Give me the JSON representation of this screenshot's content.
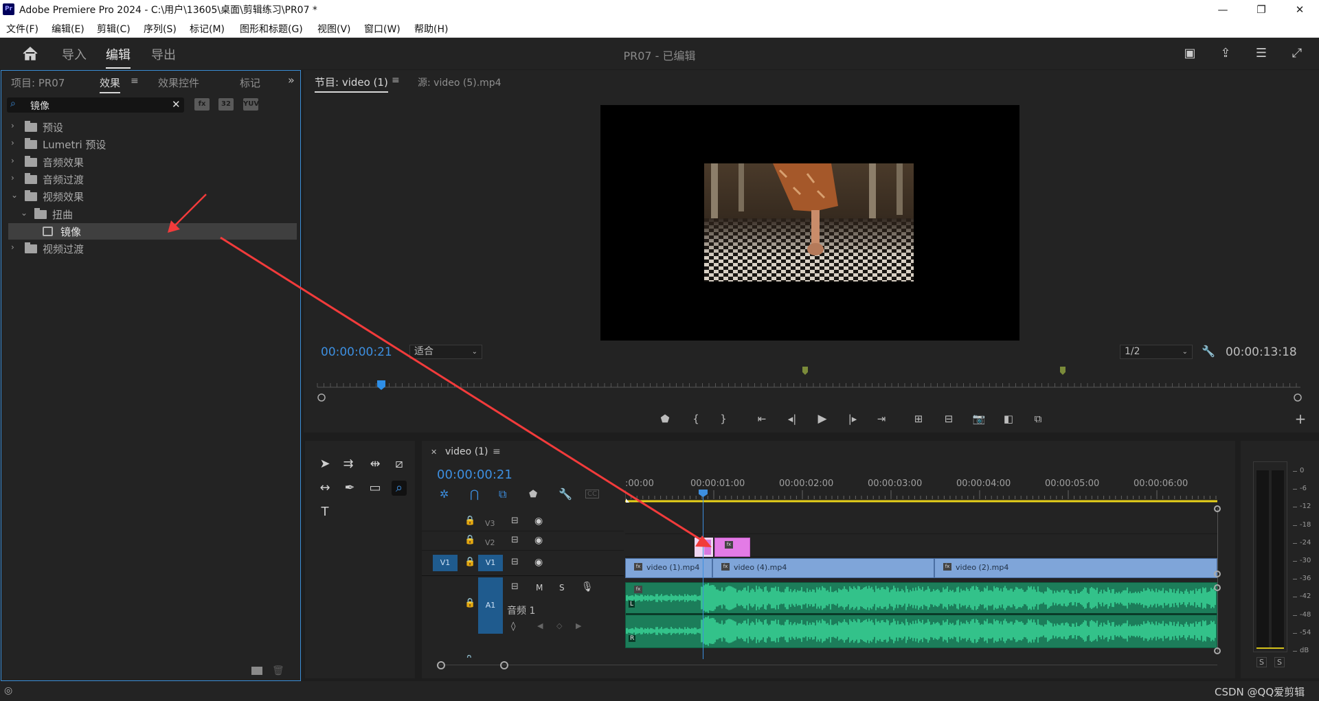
{
  "titlebar": {
    "app_title": "Adobe Premiere Pro 2024 - C:\\用户\\13605\\桌面\\剪辑练习\\PR07 *",
    "minimize": "—",
    "restore": "❐",
    "close": "✕"
  },
  "menu": [
    "文件(F)",
    "编辑(E)",
    "剪辑(C)",
    "序列(S)",
    "标记(M)",
    "图形和标题(G)",
    "视图(V)",
    "窗口(W)",
    "帮助(H)"
  ],
  "workspace": {
    "tabs": [
      "导入",
      "编辑",
      "导出"
    ],
    "active": "编辑",
    "doc_title": "PR07 - 已编辑"
  },
  "project_panel": {
    "tabs": [
      "项目: PR07",
      "效果",
      "效果控件",
      "标记"
    ],
    "active_tab": "效果",
    "search_value": "镜像",
    "filter_buttons": [
      "32",
      "YUV"
    ],
    "tree": [
      {
        "label": "预设",
        "level": 0,
        "expanded": false,
        "type": "preset-folder"
      },
      {
        "label": "Lumetri 预设",
        "level": 0,
        "expanded": false,
        "type": "preset-folder"
      },
      {
        "label": "音频效果",
        "level": 0,
        "expanded": false,
        "type": "folder"
      },
      {
        "label": "音频过渡",
        "level": 0,
        "expanded": false,
        "type": "folder"
      },
      {
        "label": "视频效果",
        "level": 0,
        "expanded": true,
        "type": "folder"
      },
      {
        "label": "扭曲",
        "level": 1,
        "expanded": true,
        "type": "folder"
      },
      {
        "label": "镜像",
        "level": 2,
        "selected": true,
        "type": "effect"
      },
      {
        "label": "视频过渡",
        "level": 0,
        "expanded": false,
        "type": "folder"
      }
    ]
  },
  "program_monitor": {
    "tabs": [
      "节目: video (1)",
      "源: video (5).mp4"
    ],
    "active_tab": "节目: video (1)",
    "current_timecode": "00:00:00:21",
    "zoom": "适合",
    "resolution": "1/2",
    "duration": "00:00:13:18"
  },
  "timeline": {
    "sequence_name": "video (1)",
    "timecode": "00:00:00:21",
    "ruler_labels": [
      ":00:00",
      "00:00:01:00",
      "00:00:02:00",
      "00:00:03:00",
      "00:00:04:00",
      "00:00:05:00",
      "00:00:06:00"
    ],
    "tracks": {
      "v3": "V3",
      "v2": "V2",
      "v1": "V1",
      "v1_source": "V1",
      "a1": "A1",
      "a1_name": "音频 1",
      "m": "M",
      "s": "S"
    },
    "clips": [
      "video (1).mp4",
      "video (4).mp4",
      "video (2).mp4"
    ],
    "waveform_channels": [
      "L",
      "R"
    ]
  },
  "audio_meter": {
    "scale": [
      "0",
      "-6",
      "-12",
      "-18",
      "-24",
      "-30",
      "-36",
      "-42",
      "-48",
      "-54",
      "dB"
    ],
    "solo": [
      "S",
      "S"
    ]
  },
  "status": {
    "watermark": "CSDN @QQ爱剪辑"
  }
}
